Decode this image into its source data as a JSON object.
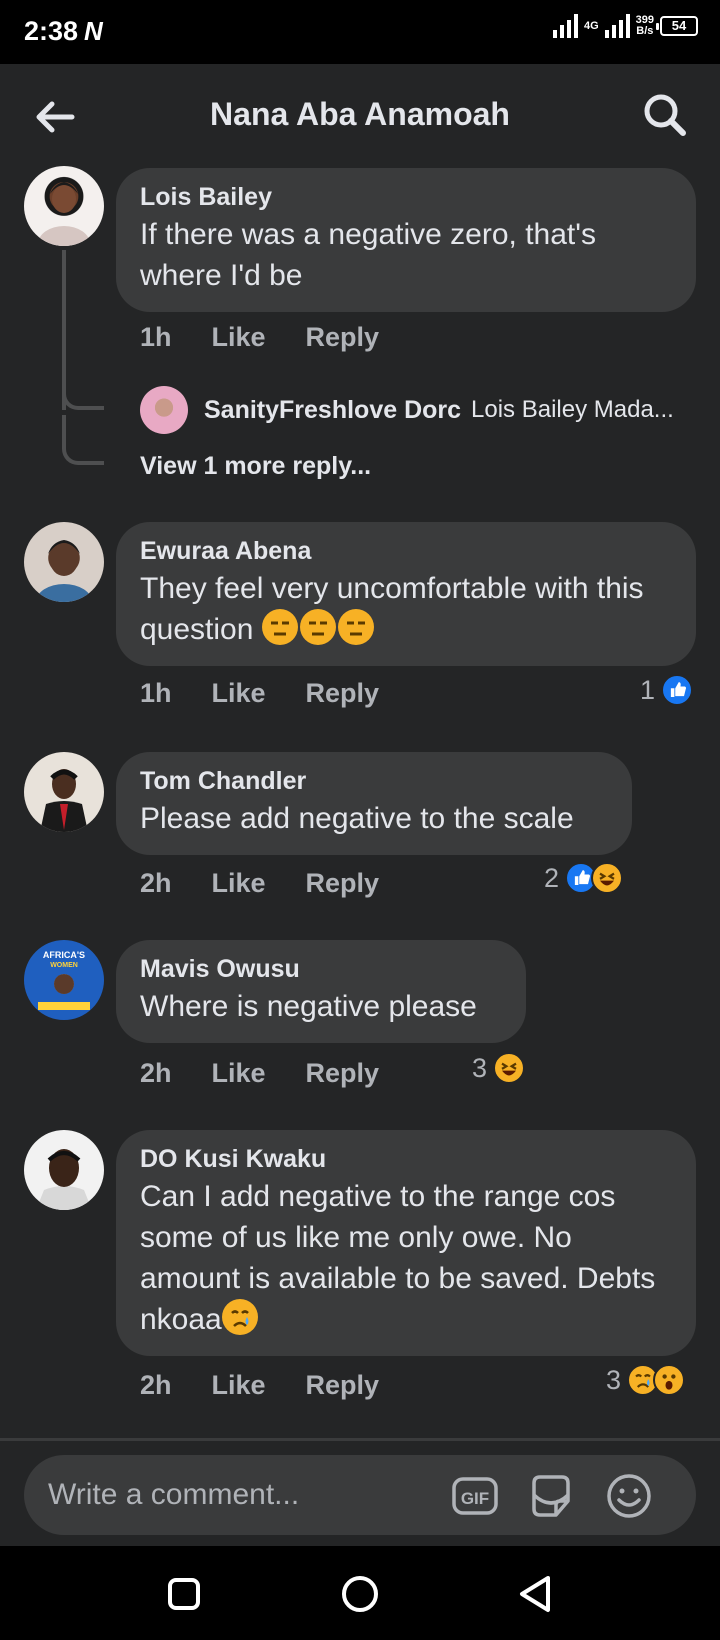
{
  "status_bar": {
    "time": "2:38",
    "carrier_icon": "N",
    "network_speed_top": "399",
    "network_speed_bottom": "B/s",
    "network_type": "4G",
    "battery": "54"
  },
  "header": {
    "title": "Nana Aba Anamoah",
    "back_icon": "arrow-left-icon",
    "search_icon": "search-icon"
  },
  "comments": [
    {
      "name": "Lois Bailey",
      "text": "If there was a negative zero, that's where I'd be",
      "time": "1h",
      "like_label": "Like",
      "reply_label": "Reply",
      "replies": {
        "author": "SanityFreshlove Dorc",
        "preview": "Lois Bailey Mada...",
        "more_label": "View 1 more reply..."
      }
    },
    {
      "name": "Ewuraa Abena",
      "text": "They feel very uncomfortable with this question",
      "emojis": [
        "unamused",
        "unamused",
        "unamused"
      ],
      "time": "1h",
      "like_label": "Like",
      "reply_label": "Reply",
      "reaction_count": "1",
      "reactions": [
        "like"
      ]
    },
    {
      "name": "Tom Chandler",
      "text": "Please add negative to the scale",
      "time": "2h",
      "like_label": "Like",
      "reply_label": "Reply",
      "reaction_count": "2",
      "reactions": [
        "like",
        "haha"
      ]
    },
    {
      "name": "Mavis Owusu",
      "text": "Where is negative please",
      "time": "2h",
      "like_label": "Like",
      "reply_label": "Reply",
      "reaction_count": "3",
      "reactions": [
        "haha"
      ]
    },
    {
      "name": "DO Kusi Kwaku",
      "text": "Can I add negative to the range cos some of us like me only owe. No amount is available to be saved. Debts nkoaa",
      "emojis": [
        "crying"
      ],
      "time": "2h",
      "like_label": "Like",
      "reply_label": "Reply",
      "reaction_count": "3",
      "reactions": [
        "sad",
        "wow"
      ]
    }
  ],
  "composer": {
    "placeholder": "Write a comment...",
    "gif_label": "GIF",
    "sticker_icon": "sticker-icon",
    "emoji_icon": "emoji-icon"
  },
  "nav_bar": {
    "recent_icon": "square-icon",
    "home_icon": "circle-icon",
    "back_icon": "triangle-back-icon"
  },
  "colors": {
    "background": "#242526",
    "bubble": "#3a3b3c",
    "text": "#e4e6eb",
    "muted": "#b0b3b8",
    "like_blue": "#1877f2",
    "emoji_yellow": "#f7b125"
  }
}
